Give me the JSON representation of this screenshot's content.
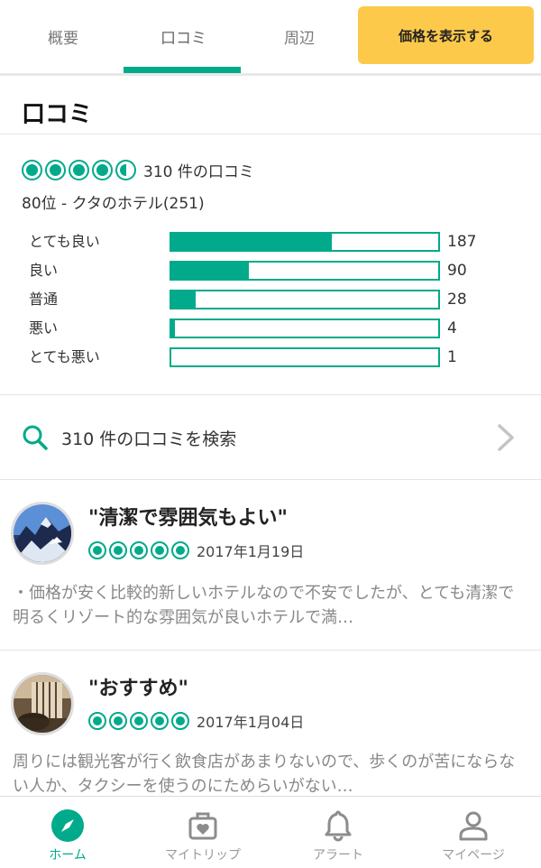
{
  "tabs": {
    "overview": "概要",
    "reviews": "口コミ",
    "nearby": "周辺",
    "price_button": "価格を表示する"
  },
  "section_title": "口コミ",
  "summary": {
    "rating": 4.5,
    "count_text": "310 件の口コミ",
    "rank_text": "80位 - クタのホテル(251)",
    "distribution": [
      {
        "label": "とても良い",
        "count": "187",
        "fraction": 0.6
      },
      {
        "label": "良い",
        "count": "90",
        "fraction": 0.29
      },
      {
        "label": "普通",
        "count": "28",
        "fraction": 0.09
      },
      {
        "label": "悪い",
        "count": "4",
        "fraction": 0.013
      },
      {
        "label": "とても悪い",
        "count": "1",
        "fraction": 0.0
      }
    ]
  },
  "search": {
    "label": "310 件の口コミを検索",
    "icon": "search-icon",
    "chevron": "chevron-right-icon"
  },
  "reviews": [
    {
      "title": "\"清潔で雰囲気もよい\"",
      "rating": 5,
      "date": "2017年1月19日",
      "body": "・価格が安く比較的新しいホテルなので不安でしたが、とても清潔で明るくリゾート的な雰囲気が良いホテルで満…"
    },
    {
      "title": "\"おすすめ\"",
      "rating": 5,
      "date": "2017年1月04日",
      "body": "周りには観光客が行く飲食店があまりないので、歩くのが苦にならない人か、タクシーを使うのにためらいがない…"
    }
  ],
  "bottom_nav": {
    "home": "ホーム",
    "mytrip": "マイトリップ",
    "alert": "アラート",
    "mypage": "マイページ"
  },
  "colors": {
    "accent": "#00aa8a",
    "price_button": "#fcc94a"
  }
}
